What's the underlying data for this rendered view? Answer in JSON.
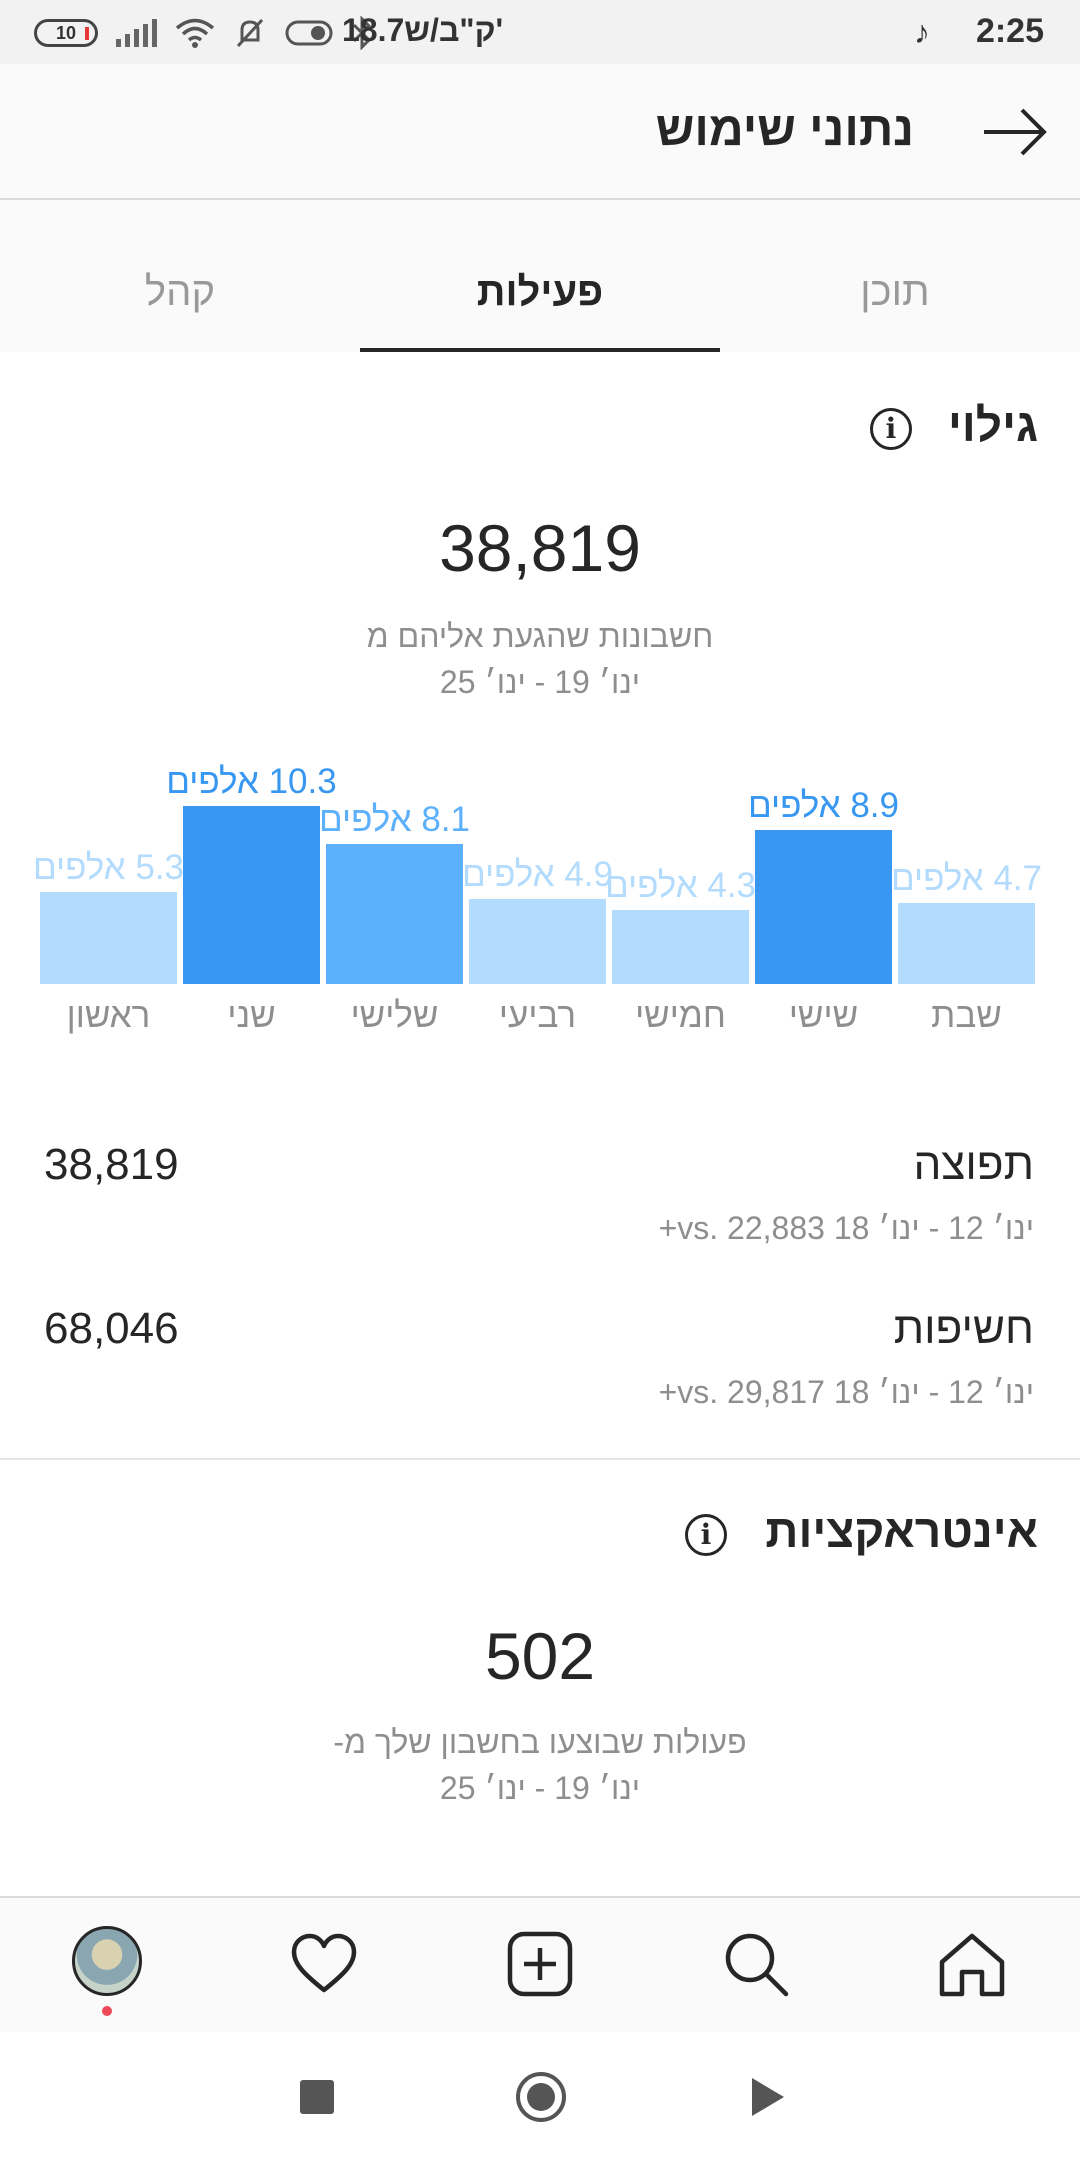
{
  "status_bar": {
    "time": "2:25",
    "speed": "18.7ק\"ב/ש'",
    "battery": "10"
  },
  "header": {
    "title": "נתוני שימוש"
  },
  "tabs": [
    {
      "label": "תוכן",
      "active": false
    },
    {
      "label": "פעילות",
      "active": true
    },
    {
      "label": "קהל",
      "active": false
    }
  ],
  "discovery": {
    "title": "גילוי",
    "value": "38,819",
    "caption": "חשבונות שהגעת אליהם מ",
    "date_range": "ינו׳ 19 - ינו׳ 25"
  },
  "chart_data": {
    "type": "bar",
    "categories": [
      "ראשון",
      "שני",
      "שלישי",
      "רביעי",
      "חמישי",
      "שישי",
      "שבת"
    ],
    "values": [
      5.3,
      10.3,
      8.1,
      4.9,
      4.3,
      8.9,
      4.7
    ],
    "data_labels": [
      "5.3 אלפים",
      "10.3 אלפים",
      "8.1 אלפים",
      "4.9 אלפים",
      "4.3 אלפים",
      "8.9 אלפים",
      "4.7 אלפים"
    ],
    "bar_colors": [
      "#b3dbfe",
      "#3897f0",
      "#5db0fb",
      "#b3dbfe",
      "#b3dbfe",
      "#3897f0",
      "#b3dbfe"
    ],
    "label_colors": [
      "#b3dbfe",
      "#3897f0",
      "#5db0fb",
      "#b3dbfe",
      "#b3dbfe",
      "#3897f0",
      "#b3dbfe"
    ],
    "ylim": [
      0,
      11
    ]
  },
  "stats": [
    {
      "label": "תפוצה",
      "value": "38,819",
      "sub": "ינו׳ 12 - ינו׳ 18 vs. 22,883+"
    },
    {
      "label": "חשיפות",
      "value": "68,046",
      "sub": "ינו׳ 12 - ינו׳ 18 vs. 29,817+"
    }
  ],
  "interactions": {
    "title": "אינטראקציות",
    "value": "502",
    "caption": "פעולות שבוצעו בחשבון שלך מ-",
    "date_range": "ינו׳ 19 - ינו׳ 25"
  },
  "colors": {
    "accent": "#3897f0",
    "text": "#262626",
    "muted": "#8e8e8e"
  }
}
